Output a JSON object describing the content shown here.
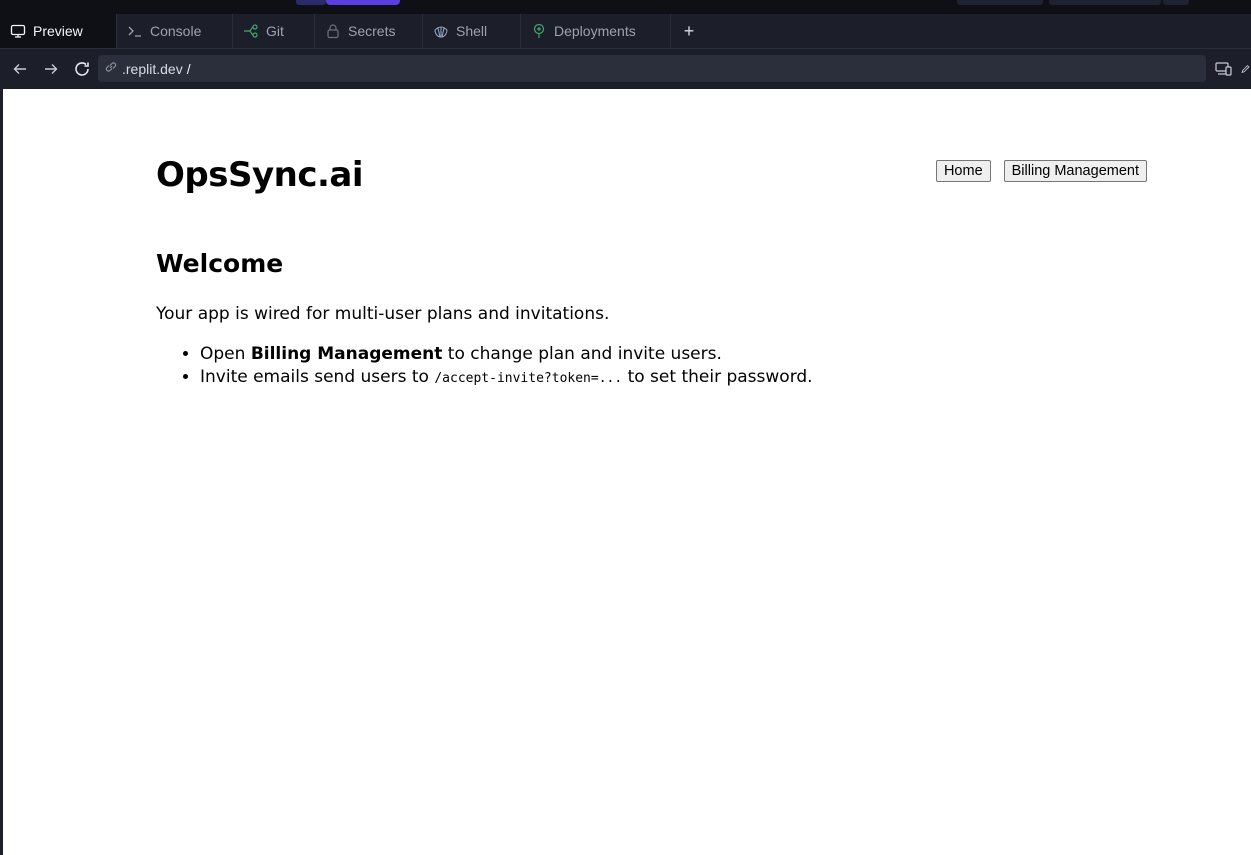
{
  "tabs": [
    {
      "label": "Preview",
      "icon": "monitor-icon",
      "active": true
    },
    {
      "label": "Console",
      "icon": "terminal-icon",
      "active": false
    },
    {
      "label": "Git",
      "icon": "git-branch-icon",
      "active": false
    },
    {
      "label": "Secrets",
      "icon": "lock-icon",
      "active": false
    },
    {
      "label": "Shell",
      "icon": "shell-icon",
      "active": false
    },
    {
      "label": "Deployments",
      "icon": "deploy-icon",
      "active": false
    }
  ],
  "add_tab_label": "+",
  "address": {
    "host": ".replit.dev",
    "path": "/"
  },
  "app": {
    "brand": "OpsSync.ai",
    "nav": {
      "home": "Home",
      "billing": "Billing Management"
    },
    "heading": "Welcome",
    "lead": "Your app is wired for multi-user plans and invitations.",
    "bullet1": {
      "pre": "Open ",
      "strong": "Billing Management",
      "post": " to change plan and invite users."
    },
    "bullet2": {
      "pre": "Invite emails send users to ",
      "code": "/accept-invite?token=...",
      "post": " to set their password."
    }
  },
  "colors": {
    "accent": "#5a3fe0",
    "chrome_bg": "#1c1f2a",
    "git_green": "#3fa66b"
  }
}
